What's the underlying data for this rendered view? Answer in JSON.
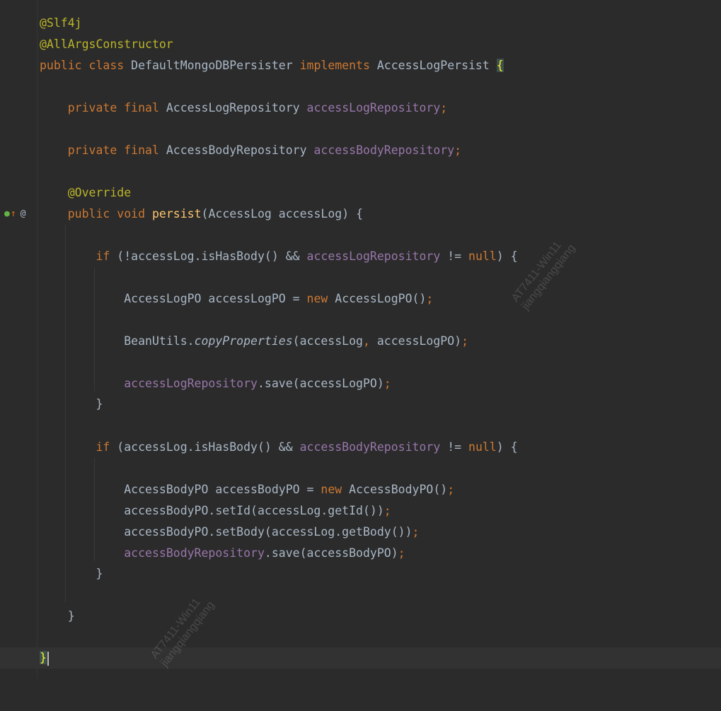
{
  "gutter": {
    "implements_icon": "implementing-method-icon",
    "override_icon": "annotation-at-icon",
    "at_symbol": "@"
  },
  "code": {
    "anno_slf4j": "@Slf4j",
    "anno_allargs": "@AllArgsConstructor",
    "kw_public": "public",
    "kw_class": "class",
    "class_name": "DefaultMongoDBPersister",
    "kw_implements": "implements",
    "iface_name": "AccessLogPersist",
    "open_brace": "{",
    "kw_private": "private",
    "kw_final": "final",
    "type_log_repo": "AccessLogRepository",
    "field_log_repo": "accessLogRepository",
    "type_body_repo": "AccessBodyRepository",
    "field_body_repo": "accessBodyRepository",
    "semicolon": ";",
    "anno_override": "@Override",
    "kw_void": "void",
    "method_persist": "persist",
    "param_list": "(AccessLog accessLog) {",
    "kw_if": "if",
    "cond1_a": " (!accessLog.isHasBody() && ",
    "cond_ne": " != ",
    "kw_null": "null",
    "cond_close": ") {",
    "type_logpo": "AccessLogPO",
    "var_logpo": " accessLogPO = ",
    "kw_new": "new",
    "ctor_logpo": " AccessLogPO()",
    "bean_utils": "BeanUtils.",
    "copy_props": "copyProperties",
    "copy_args_a": "(accessLog",
    "comma": ",",
    "copy_args_b": " accessLogPO)",
    "save_dot": ".save(accessLogPO)",
    "close_brace": "}",
    "cond2_a": " (accessLog.isHasBody() && ",
    "type_bodypo": "AccessBodyPO",
    "var_bodypo": " accessBodyPO = ",
    "ctor_bodypo": " AccessBodyPO()",
    "set_id": "accessBodyPO.setId(accessLog.getId())",
    "set_body": "accessBodyPO.setBody(accessLog.getBody())",
    "save_body_dot": ".save(accessBodyPO)",
    "final_brace": "}"
  },
  "watermark": {
    "line1": "AT7411-Win11",
    "line2": "jiangqiangqiang"
  },
  "colors": {
    "background": "#2b2b2b",
    "keyword": "#cc7832",
    "annotation": "#bbb529",
    "field": "#9876aa",
    "method": "#ffc66d",
    "text": "#a9b7c6"
  }
}
